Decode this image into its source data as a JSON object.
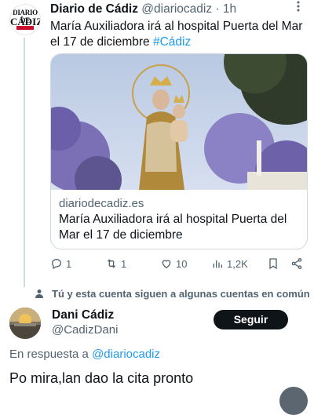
{
  "tweet": {
    "avatar": {
      "line1": "DIARIO DE",
      "line2": "CÁDIZ"
    },
    "display_name": "Diario de Cádiz",
    "handle": "@diariocadiz",
    "separator": "·",
    "time": "1h",
    "more_icon": "more-vertical-icon",
    "text": "María Auxiliadora irá al hospital Puerta del Mar el 17 de diciembre ",
    "hashtag": "#Cádiz",
    "card": {
      "domain": "diariodecadiz.es",
      "title": "María Auxiliadora irá al hospital Puerta del Mar el 17 de diciembre"
    },
    "actions": {
      "replies": "1",
      "retweets": "1",
      "likes": "10",
      "views": "1,2K"
    }
  },
  "social_context": "Tú y esta cuenta siguen a algunas cuentas en común",
  "reply": {
    "display_name": "Dani Cádiz",
    "handle": "@CadizDani",
    "follow_label": "Seguir",
    "in_reply_prefix": "En respuesta a ",
    "in_reply_handle": "@diariocadiz",
    "text": "Po mira,lan dao la cita pronto"
  },
  "colors": {
    "link": "#1d9bf0",
    "text": "#0f1419",
    "muted": "#536471",
    "brand_red": "#c8102e"
  }
}
